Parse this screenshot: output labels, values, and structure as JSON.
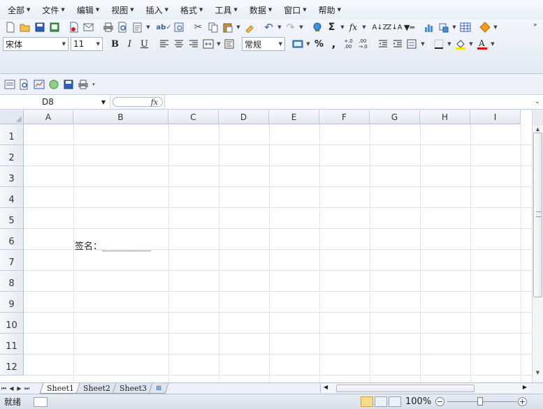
{
  "menu": {
    "items": [
      {
        "label": "全部",
        "icon": "chevron-down-icon"
      },
      {
        "label": "文件",
        "icon": "chevron-down-icon"
      },
      {
        "label": "编辑",
        "icon": "chevron-down-icon"
      },
      {
        "label": "视图",
        "icon": "chevron-down-icon"
      },
      {
        "label": "插入",
        "icon": "chevron-down-icon"
      },
      {
        "label": "格式",
        "icon": "chevron-down-icon"
      },
      {
        "label": "工具",
        "icon": "chevron-down-icon"
      },
      {
        "label": "数据",
        "icon": "chevron-down-icon"
      },
      {
        "label": "窗口",
        "icon": "chevron-down-icon"
      },
      {
        "label": "帮助",
        "icon": "chevron-down-icon"
      }
    ]
  },
  "toolbar": {
    "font_name": "宋体",
    "font_size": "11",
    "number_format": "常规",
    "bold_label": "B",
    "italic_label": "I",
    "underline_label": "U",
    "percent_label": "%",
    "comma_label": ",",
    "sum_label": "Σ",
    "function_label": "fx",
    "increase_decimal_label": "+.0\n.00",
    "decrease_decimal_label": ".00\n→.0"
  },
  "formula_bar": {
    "name_box": "D8",
    "fx_label": "fx",
    "formula": ""
  },
  "grid": {
    "columns": [
      "A",
      "B",
      "C",
      "D",
      "E",
      "F",
      "G",
      "H",
      "I"
    ],
    "rows": [
      "1",
      "2",
      "3",
      "4",
      "5",
      "6",
      "7",
      "8",
      "9",
      "10",
      "11",
      "12"
    ],
    "cells": {
      "B6": "签名：_________"
    }
  },
  "sheets": {
    "tabs": [
      "Sheet1",
      "Sheet2",
      "Sheet3"
    ],
    "active": "Sheet1"
  },
  "status_bar": {
    "ready_text": "就绪",
    "zoom": "100%",
    "zoom_out_label": "−",
    "zoom_in_label": "+"
  },
  "colors": {
    "font_color_bar": "#e00000",
    "fill_color_bar": "#ffe600"
  }
}
